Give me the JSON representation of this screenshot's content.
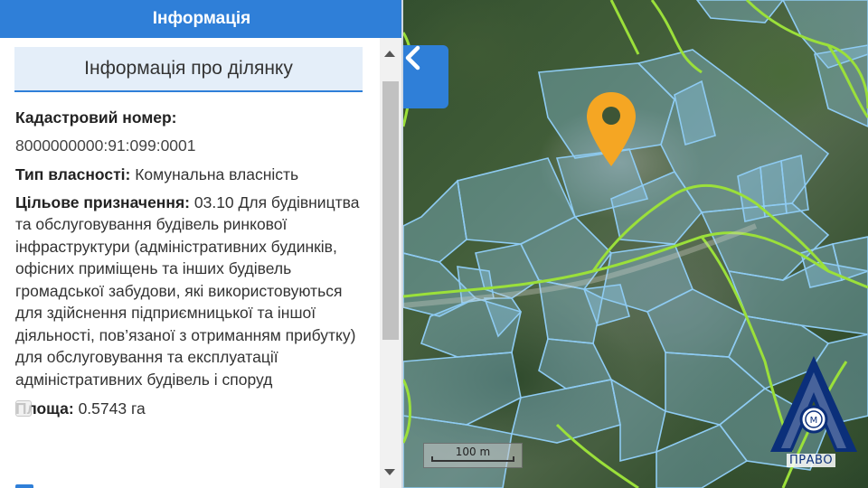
{
  "panel": {
    "header_title": "Інформація",
    "section_title": "Інформація про ділянку",
    "cadastral_label": "Кадастровий номер:",
    "cadastral_number": "8000000000:91:099:0001",
    "ownership_label": "Тип власності:",
    "ownership_value": "Комунальна власність",
    "purpose_label": "Цільове призначення:",
    "purpose_value": "03.10 Для будівництва та обслуговування будівель ринкової інфраструктури (адміністративних будинків, офісних приміщень та інших будівель громадської забудови, які використовуються для здійснення підприємницької та іншої діяльності, пов’язаної з отриманням прибутку) для обслуговування та експлуатації адміністративних будівель і споруд",
    "area_label": "Площа:",
    "area_value": "0.5743 га"
  },
  "map": {
    "collapse_icon": "chevron-left-icon",
    "marker_icon": "map-pin-icon",
    "marker_color": "#f5a623",
    "parcel_color": "#8ecbf2",
    "boundary_color": "#9be03a",
    "scale_label": "100 m"
  },
  "logo": {
    "text": "ПРАВО",
    "color": "#0b2f7a"
  },
  "colors": {
    "accent": "#2f7fd8",
    "section_bg": "#e4eef9"
  }
}
